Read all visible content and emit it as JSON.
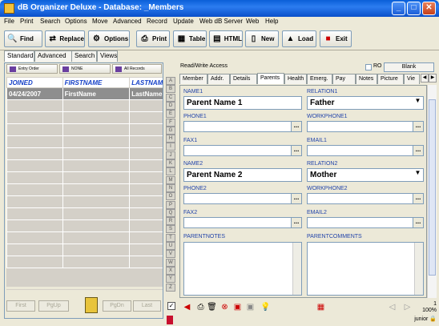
{
  "window": {
    "title": "dB Organizer Deluxe - Database: _Members",
    "minimize": "_",
    "maximize": "□",
    "close": "✕"
  },
  "menu": [
    "File",
    "Print",
    "Search",
    "Options",
    "Move",
    "Advanced",
    "Record",
    "Update",
    "Web dB Server",
    "Web",
    "Help"
  ],
  "toolbar": {
    "find": "Find",
    "replace": "Replace",
    "options": "Options",
    "print": "Print",
    "table": "Table",
    "html": "HTML",
    "new": "New",
    "load": "Load",
    "exit": "Exit"
  },
  "left_tabs": [
    "Standard",
    "Advanced",
    "Search",
    "Views"
  ],
  "sort": {
    "entry_order": "Entry Order",
    "none": "NONE",
    "all_records": "All Records"
  },
  "grid": {
    "columns": [
      "JOINED",
      "FIRSTNAME",
      "LASTNAME"
    ],
    "rows": [
      [
        "04/24/2007",
        "FirstName",
        "LastName"
      ]
    ]
  },
  "nav": {
    "first": "First",
    "pgup": "PgUp",
    "pgdn": "PgDn",
    "last": "Last"
  },
  "alpha": [
    "A",
    "B",
    "C",
    "D",
    "E",
    "F",
    "G",
    "H",
    "I",
    "J",
    "K",
    "L",
    "M",
    "N",
    "O",
    "P",
    "Q",
    "R",
    "S",
    "T",
    "U",
    "V",
    "W",
    "X",
    "Y",
    "Z"
  ],
  "access": {
    "label": "Read/Write Access",
    "ro": "RO",
    "blank": "Blank"
  },
  "tabs": [
    "Member",
    "Addr.",
    "Details",
    "Parents",
    "Health",
    "Emerg.",
    "Pay",
    "Notes",
    "Picture",
    "Vie"
  ],
  "active_tab": "Parents",
  "fields": {
    "name1_label": "NAME1",
    "name1_value": "Parent Name 1",
    "relation1_label": "RELATION1",
    "relation1_value": "Father",
    "phone1_label": "PHONE1",
    "workphone1_label": "WORKPHONE1",
    "fax1_label": "FAX1",
    "email1_label": "EMAIL1",
    "name2_label": "NAME2",
    "name2_value": "Parent Name 2",
    "relation2_label": "RELATION2",
    "relation2_value": "Mother",
    "phone2_label": "PHONE2",
    "workphone2_label": "WORKPHONE2",
    "fax2_label": "FAX2",
    "email2_label": "EMAIL2",
    "parentnotes_label": "PARENTNOTES",
    "parentcomments_label": "PARENTCOMMENTS",
    "ellipsis": "..."
  },
  "status": {
    "count": "1",
    "zoom": "100%",
    "user": "junior"
  }
}
